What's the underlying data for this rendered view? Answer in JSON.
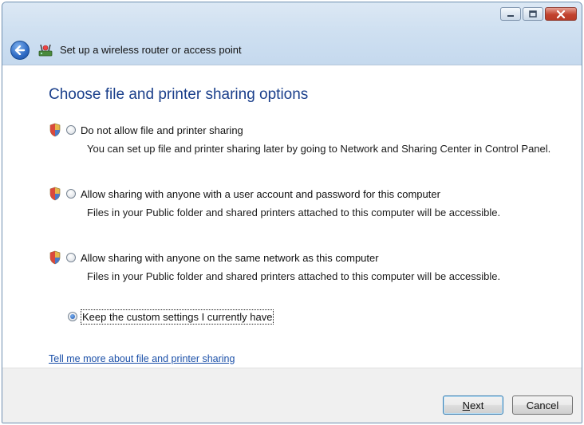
{
  "window": {
    "title": "Set up a wireless router or access point",
    "controls": {
      "minimize": "minimize-icon",
      "maximize": "maximize-icon",
      "close": "close-icon"
    }
  },
  "page": {
    "heading": "Choose file and printer sharing options",
    "options": [
      {
        "label": "Do not allow file and printer sharing",
        "description": "You can set up file and printer sharing later by going to Network and Sharing Center in Control Panel.",
        "shield": true,
        "checked": false
      },
      {
        "label": "Allow sharing with anyone with a user account and password for this computer",
        "description": "Files in your Public folder and shared printers attached to this computer will be accessible.",
        "shield": true,
        "checked": false
      },
      {
        "label": "Allow sharing with anyone on the same network as this computer",
        "description": "Files in your Public folder and shared printers attached to this computer will be accessible.",
        "shield": true,
        "checked": false
      },
      {
        "label": "Keep the custom settings I currently have",
        "description": "",
        "shield": false,
        "checked": true
      }
    ],
    "help_link": "Tell me more about file and printer sharing"
  },
  "footer": {
    "next_accel": "N",
    "next_rest": "ext",
    "cancel": "Cancel"
  },
  "colors": {
    "heading": "#1a3f8b",
    "link": "#1a4fa8",
    "titlebar": "#cfe0f1",
    "footer": "#f0f0f0"
  }
}
